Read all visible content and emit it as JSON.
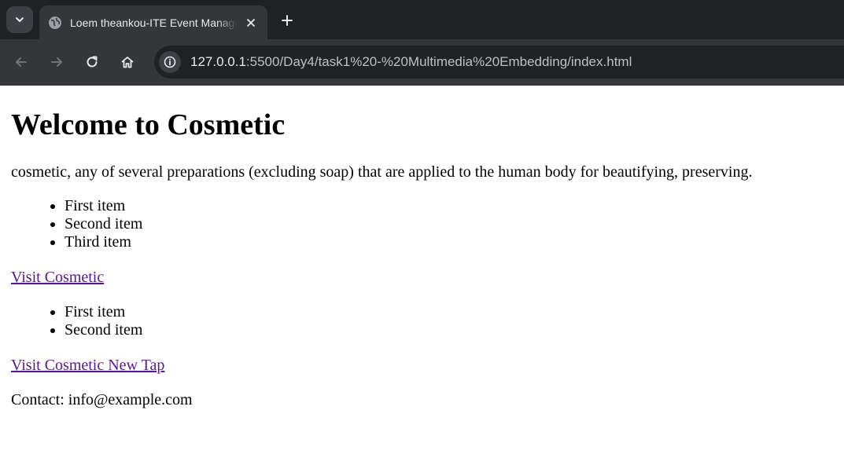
{
  "browser": {
    "tab": {
      "title": "Loem theankou-ITE Event Management"
    },
    "address": {
      "host": "127.0.0.1",
      "rest": ":5500/Day4/task1%20-%20Multimedia%20Embedding/index.html"
    },
    "icons": {
      "tab_search": "chevron-down-icon",
      "favicon": "globe-icon",
      "close": "close-icon",
      "new_tab": "plus-icon",
      "back": "arrow-left-icon",
      "forward": "arrow-right-icon",
      "reload": "reload-icon",
      "home": "home-icon",
      "site_info": "info-icon"
    }
  },
  "page": {
    "heading": "Welcome to Cosmetic",
    "description": "cosmetic, any of several preparations (excluding soap) that are applied to the human body for beautifying, preserving.",
    "list1": [
      "First item",
      "Second item",
      "Third item"
    ],
    "link1": "Visit Cosmetic",
    "list2": [
      "First item",
      "Second item"
    ],
    "link2": "Visit Cosmetic New Tap",
    "contact": "Contact: info@example.com"
  },
  "colors": {
    "tabstrip_bg": "#202124",
    "toolbar_bg": "#35363a",
    "link_visited": "#551a8b"
  }
}
